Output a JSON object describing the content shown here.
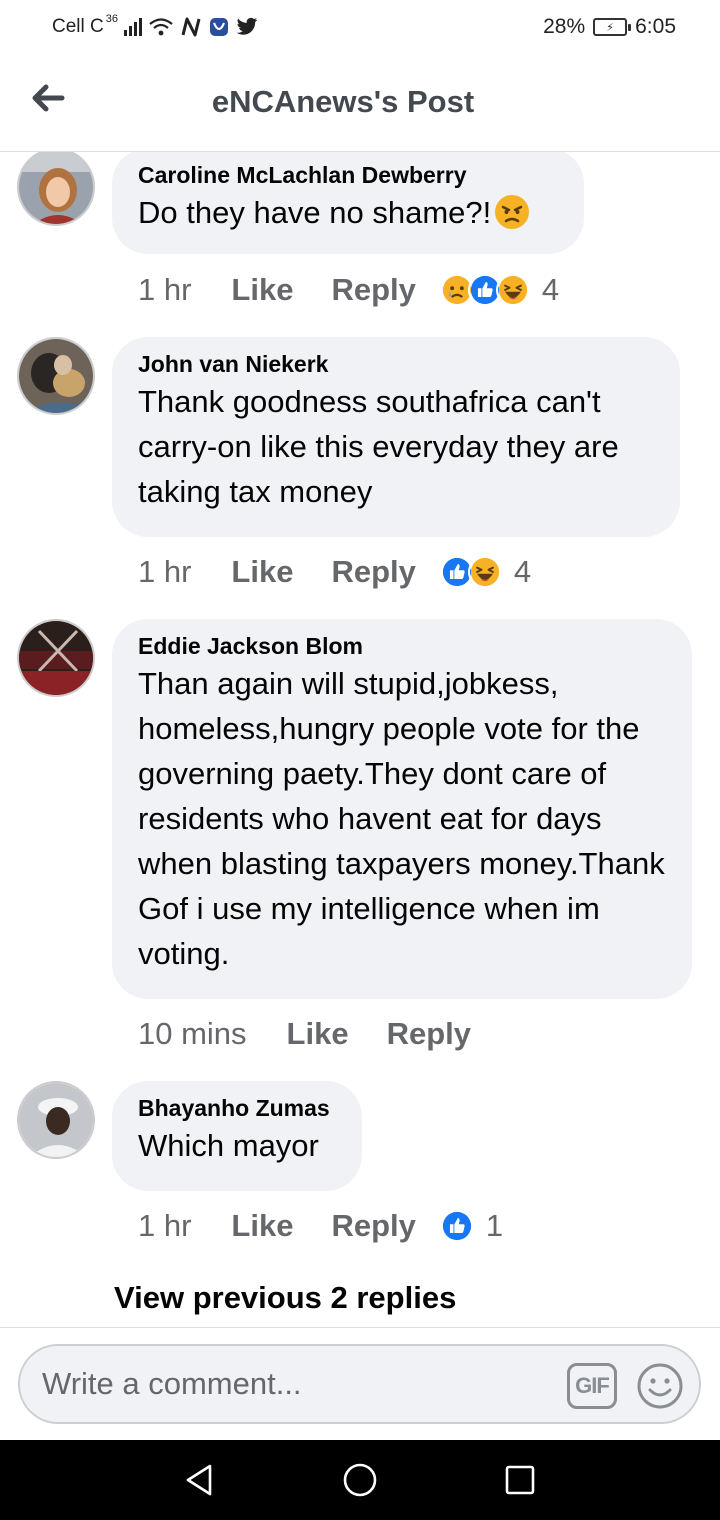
{
  "status_bar": {
    "carrier": "Cell C",
    "network_type": "36",
    "battery": "28%",
    "time": "6:05",
    "icons": [
      "signal-icon",
      "wifi-icon",
      "nfc-icon",
      "vpn-icon",
      "twitter-icon",
      "battery-icon"
    ]
  },
  "header": {
    "title": "eNCAnews's Post",
    "back_icon": "arrow-left-icon"
  },
  "comments": [
    {
      "author": "Caroline McLachlan Dewberry",
      "text": "Do they have no shame?!",
      "emoji": "angry-face-emoji",
      "time": "1 hr",
      "like_label": "Like",
      "reply_label": "Reply",
      "reactions": [
        "sad-reaction-icon",
        "like-reaction-icon",
        "haha-reaction-icon"
      ],
      "reaction_count": "4"
    },
    {
      "author": "John van Niekerk",
      "text": "Thank goodness southafrica can't carry-on like this everyday they are taking tax money",
      "time": "1 hr",
      "like_label": "Like",
      "reply_label": "Reply",
      "reactions": [
        "like-reaction-icon",
        "haha-reaction-icon"
      ],
      "reaction_count": "4"
    },
    {
      "author": "Eddie Jackson Blom",
      "text": "Than again will stupid,jobkess, homeless,hungry people vote for the governing paety.They dont care of residents who havent eat for days when blasting taxpayers money.Thank Gof i use my intelligence when im voting.",
      "time": "10 mins",
      "like_label": "Like",
      "reply_label": "Reply"
    },
    {
      "author": "Bhayanho Zumas",
      "text": "Which mayor",
      "time": "1 hr",
      "like_label": "Like",
      "reply_label": "Reply",
      "reactions": [
        "like-reaction-icon"
      ],
      "reaction_count": "1"
    }
  ],
  "view_previous_label": "View previous 2 replies",
  "composer": {
    "placeholder": "Write a comment...",
    "gif_label": "GIF",
    "emoji_icon": "smiley-icon"
  },
  "nav": {
    "icons": [
      "back-triangle-icon",
      "home-circle-icon",
      "recents-square-icon"
    ]
  },
  "colors": {
    "bubble": "#f0f2f5",
    "meta_text": "#65676b",
    "like_blue": "#1877f2",
    "haha_yellow": "#f7b125"
  }
}
